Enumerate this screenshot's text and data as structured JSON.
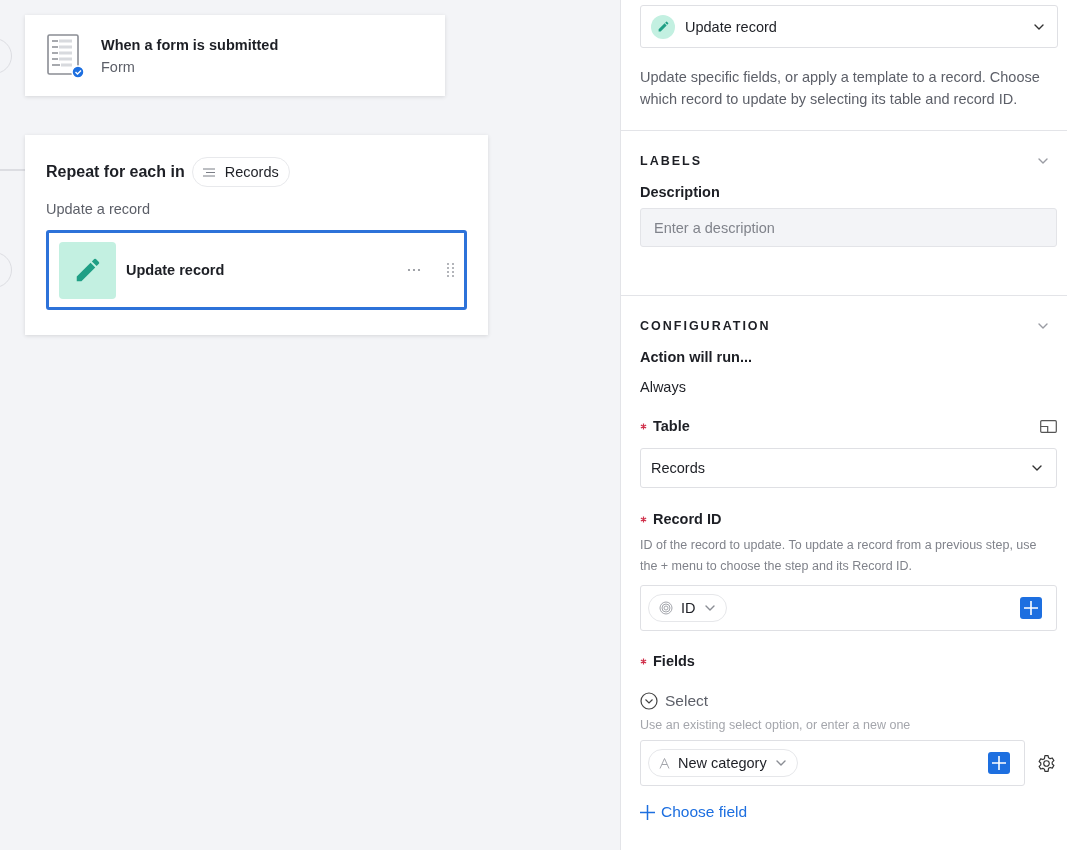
{
  "trigger": {
    "title": "When a form is submitted",
    "subtitle": "Form"
  },
  "loop": {
    "label": "Repeat for each in",
    "source": "Records",
    "group_label": "Update a record",
    "step": {
      "title": "Update record",
      "selected": true
    }
  },
  "panel": {
    "action": "Update record",
    "description": "Update specific fields, or apply a template to a record. Choose which record to update by selecting its table and record ID.",
    "labels": {
      "title": "LABELS",
      "field_label": "Description",
      "placeholder": "Enter a description"
    },
    "configuration": {
      "title": "CONFIGURATION",
      "run_label": "Action will run...",
      "run_value": "Always",
      "table": {
        "label": "Table",
        "required": true,
        "value": "Records"
      },
      "record_id": {
        "label": "Record ID",
        "required": true,
        "help": "ID of the record to update. To update a record from a previous step, use the + menu to choose the step and its Record ID.",
        "token": "ID"
      },
      "fields": {
        "label": "Fields",
        "required": true,
        "field_name": "Select",
        "help": "Use an existing select option, or enter a new one",
        "token": "New category"
      },
      "choose_field": "Choose field"
    }
  }
}
